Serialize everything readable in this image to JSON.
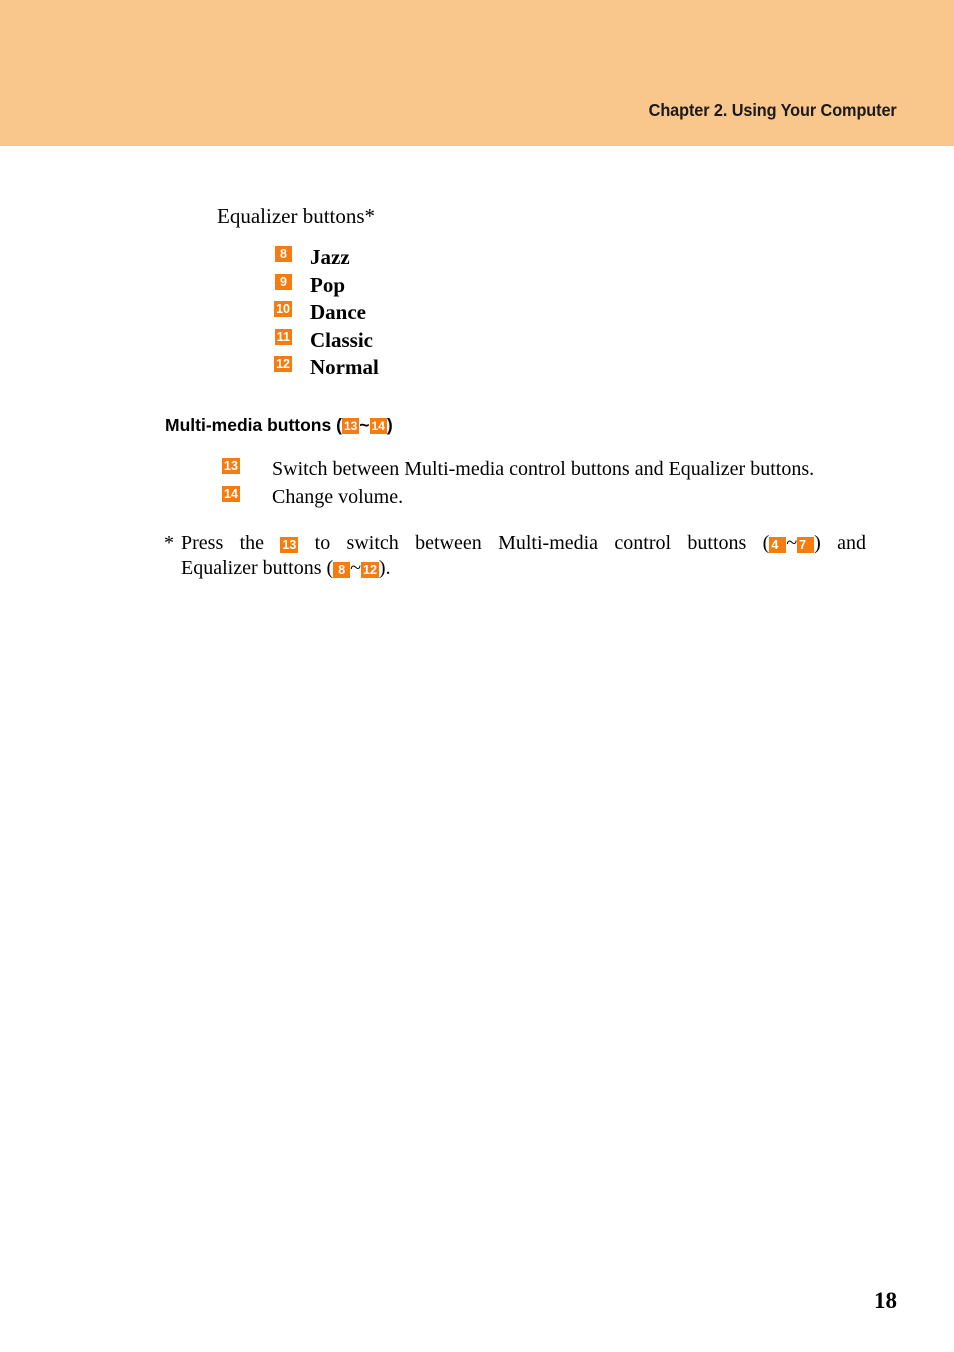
{
  "header": {
    "title": "Chapter 2. Using Your Computer",
    "background_color": "#f9c68c"
  },
  "colors": {
    "badge_background": "#f57c11",
    "badge_text": "#ffffff",
    "header_band": "#f9c68c",
    "body_text": "#000000"
  },
  "main": {
    "intro_label": "Equalizer buttons*",
    "equalizer_items": [
      {
        "number": "8",
        "label": "Jazz"
      },
      {
        "number": "9",
        "label": "Pop"
      },
      {
        "number": "10",
        "label": "Dance"
      },
      {
        "number": "11",
        "label": "Classic"
      },
      {
        "number": "12",
        "label": "Normal"
      }
    ],
    "multimedia_heading": {
      "prefix": "Multi-media buttons (",
      "badge_start": "13",
      "separator": "~",
      "badge_end": "14",
      "suffix": ")"
    },
    "multimedia_items": [
      {
        "number": "13",
        "text": "Switch between Multi-media control buttons and Equalizer buttons."
      },
      {
        "number": "14",
        "text": "Change volume."
      }
    ],
    "footnote": {
      "marker": "*",
      "part1": "Press the",
      "badge1": "13",
      "part2": "to switch between Multi-media control buttons (",
      "badge2": "4",
      "separator2": "~",
      "badge3": "7",
      "part3": ") and",
      "part4": "Equalizer buttons (",
      "badge4": "8",
      "separator3": "~",
      "badge5": "12",
      "part5": ")."
    }
  },
  "footer": {
    "page_number": "18"
  }
}
